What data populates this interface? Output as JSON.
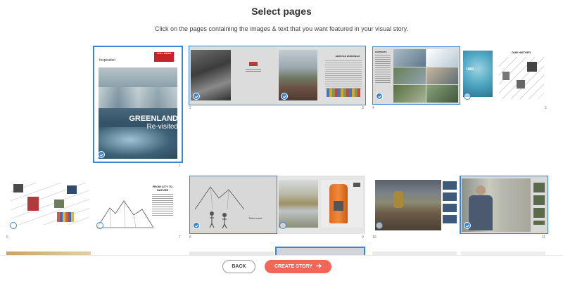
{
  "header": {
    "title": "Select pages",
    "subtitle": "Click on the pages containing the images & text that you want featured in your visual story."
  },
  "cover": {
    "section_label": "Inspiration",
    "logo_text": "FJÄLL RÄVEN",
    "headline": "GREENLAND",
    "subhead": "Re-visited",
    "page_number": "1"
  },
  "spreads": {
    "s23": {
      "left_num": "2",
      "right_num": "3",
      "right_heading": "HERITAGE WORKWEAR",
      "left_selected": true,
      "right_selected": true
    },
    "s45": {
      "left_num": "4",
      "right_num": "5",
      "left_heading": "CONTENTS",
      "right_heading": "OUR HISTORY",
      "year": "1960",
      "left_selected": true,
      "right_selected": false
    },
    "s67": {
      "left_num": "6",
      "right_num": "7",
      "right_heading": "FROM CITY TO NATURE",
      "left_selected": false,
      "right_selected": false
    },
    "s89": {
      "left_num": "8",
      "right_num": "9",
      "left_caption": "Tailormade",
      "left_selected": true,
      "right_selected": false
    },
    "s1011": {
      "left_num": "10",
      "right_num": "11",
      "left_selected": false,
      "right_selected": true
    }
  },
  "footer": {
    "back_label": "BACK",
    "create_label": "CREATE STORY",
    "create_arrow": "arrow-right-icon"
  },
  "colors": {
    "accent": "#3a86d4",
    "create_button": "#f0675a"
  }
}
